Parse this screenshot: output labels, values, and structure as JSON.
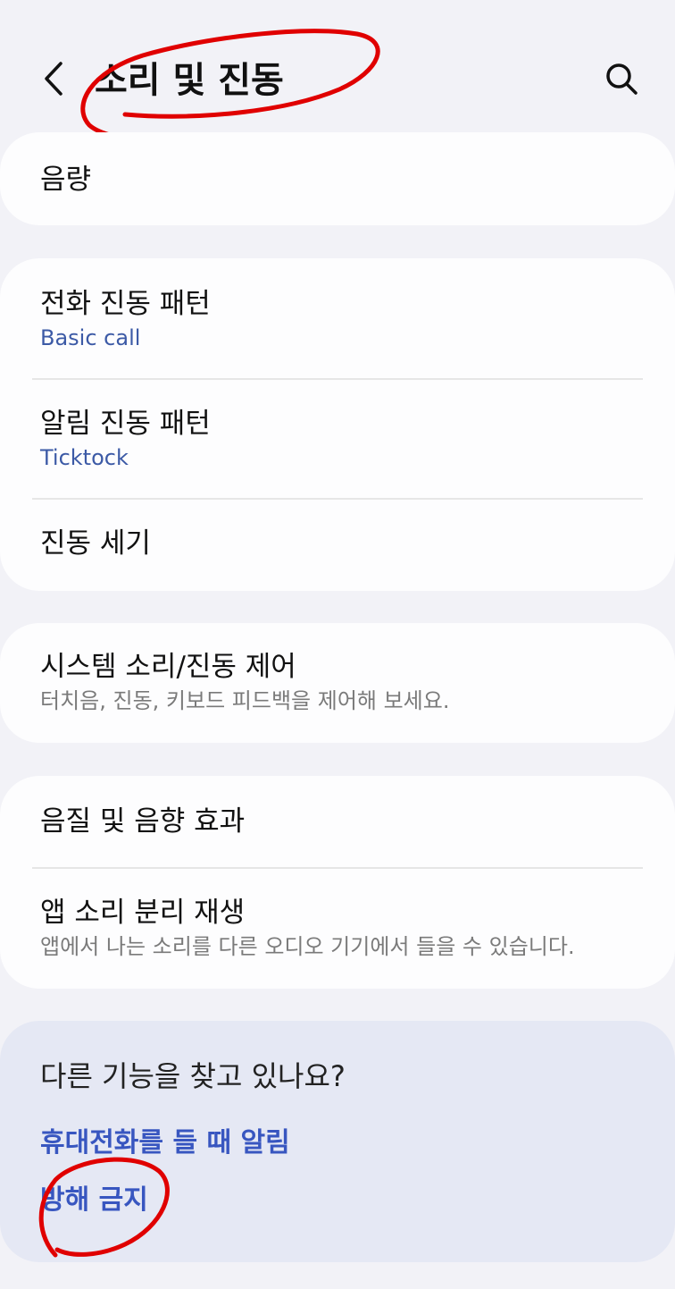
{
  "header": {
    "title": "소리 및 진동",
    "back_icon": "chevron-left-icon",
    "search_icon": "search-icon"
  },
  "card_volume": {
    "volume": {
      "title": "음량"
    }
  },
  "card_vibration": {
    "call_pattern": {
      "title": "전화 진동 패턴",
      "value": "Basic call"
    },
    "notification_pattern": {
      "title": "알림 진동 패턴",
      "value": "Ticktock"
    },
    "intensity": {
      "title": "진동 세기"
    }
  },
  "card_system": {
    "system_control": {
      "title": "시스템 소리/진동 제어",
      "subtitle": "터치음, 진동, 키보드 피드백을 제어해 보세요."
    }
  },
  "card_quality": {
    "sound_quality": {
      "title": "음질 및 음향 효과"
    },
    "separate_app_sound": {
      "title": "앱 소리 분리 재생",
      "subtitle": "앱에서 나는 소리를 다른 오디오 기기에서 들을 수 있습니다."
    }
  },
  "suggestions": {
    "title": "다른 기능을 찾고 있나요?",
    "links": [
      "휴대전화를 들 때 알림",
      "방해 금지"
    ]
  },
  "colors": {
    "background": "#f2f2f7",
    "card": "#fdfdfe",
    "accent_value": "#3c5aa6",
    "link": "#3856c0",
    "suggest_bg": "#e5e8f4",
    "annotation": "#e00000"
  }
}
